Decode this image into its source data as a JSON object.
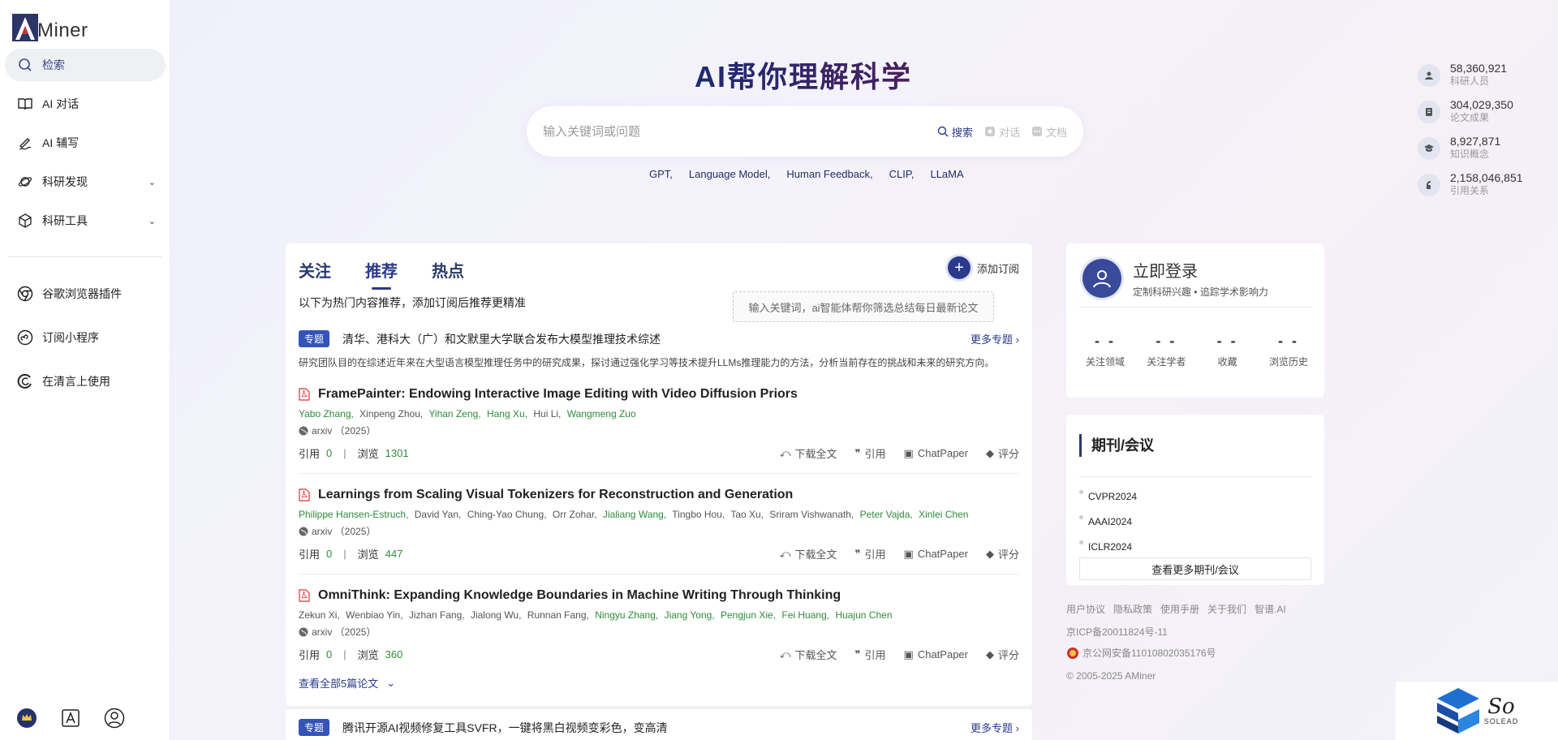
{
  "app": {
    "logo_text": "Miner",
    "logo_letter": "A"
  },
  "sidebar": {
    "items": [
      {
        "label": "检索",
        "icon": "search-icon"
      },
      {
        "label": "AI 对话",
        "icon": "book-icon"
      },
      {
        "label": "AI 辅写",
        "icon": "pen-icon"
      },
      {
        "label": "科研发现",
        "icon": "planet-icon"
      },
      {
        "label": "科研工具",
        "icon": "cube-icon"
      }
    ],
    "extras": [
      {
        "label": "谷歌浏览器插件",
        "icon": "chrome-icon"
      },
      {
        "label": "订阅小程序",
        "icon": "miniprogram-icon"
      },
      {
        "label": "在清言上使用",
        "icon": "chatglm-icon"
      }
    ]
  },
  "hero": {
    "title": "AI帮你理解科学",
    "search_placeholder": "输入关键词或问题",
    "search_label": "搜索",
    "chat_label": "对话",
    "doc_label": "文档",
    "hot_tags": [
      "GPT,",
      "Language Model,",
      "Human Feedback,",
      "CLIP,",
      "LLaMA"
    ]
  },
  "stats": [
    {
      "value": "58,360,921",
      "label": "科研人员",
      "icon": "person-icon"
    },
    {
      "value": "304,029,350",
      "label": "论文成果",
      "icon": "document-icon"
    },
    {
      "value": "8,927,871",
      "label": "知识概念",
      "icon": "graduation-cap-icon"
    },
    {
      "value": "2,158,046,851",
      "label": "引用关系",
      "icon": "quote-icon"
    }
  ],
  "feed": {
    "tabs": [
      "关注",
      "推荐",
      "热点"
    ],
    "active_tab": "推荐",
    "add_subscription": "添加订阅",
    "hint": "以下为热门内容推荐，添加订阅后推荐更精准",
    "tooltip": "输入关键词，ai智能体帮你筛选总结每日最新论文",
    "topic": {
      "badge": "专题",
      "title": "清华、港科大（广）和文默里大学联合发布大模型推理技术综述",
      "more": "更多专题",
      "desc": "研究团队目的在综述近年来在大型语言模型推理任务中的研究成果，探讨通过强化学习等技术提升LLMs推理能力的方法，分析当前存在的挑战和未来的研究方向。"
    },
    "papers": [
      {
        "title": "FramePainter: Endowing Interactive Image Editing with Video Diffusion Priors",
        "authors": [
          {
            "name": "Yabo Zhang,",
            "hl": true
          },
          {
            "name": "Xinpeng Zhou,",
            "hl": false
          },
          {
            "name": "Yihan Zeng,",
            "hl": true
          },
          {
            "name": "Hang Xu,",
            "hl": true
          },
          {
            "name": "Hui Li,",
            "hl": false
          },
          {
            "name": "Wangmeng Zuo",
            "hl": true
          }
        ],
        "venue": "arxiv （2025）",
        "cite_label": "引用",
        "cites": "0",
        "view_label": "浏览",
        "views": "1301"
      },
      {
        "title": "Learnings from Scaling Visual Tokenizers for Reconstruction and Generation",
        "authors": [
          {
            "name": "Philippe Hansen-Estruch,",
            "hl": true
          },
          {
            "name": "David Yan,",
            "hl": false
          },
          {
            "name": "Ching-Yao Chung,",
            "hl": false
          },
          {
            "name": "Orr Zohar,",
            "hl": false
          },
          {
            "name": "Jialiang Wang,",
            "hl": true
          },
          {
            "name": "Tingbo Hou,",
            "hl": false
          },
          {
            "name": "Tao Xu,",
            "hl": false
          },
          {
            "name": "Sriram Vishwanath,",
            "hl": false
          },
          {
            "name": "Peter Vajda,",
            "hl": true
          },
          {
            "name": "Xinlei Chen",
            "hl": true
          }
        ],
        "venue": "arxiv （2025）",
        "cite_label": "引用",
        "cites": "0",
        "view_label": "浏览",
        "views": "447"
      },
      {
        "title": "OmniThink: Expanding Knowledge Boundaries in Machine Writing Through Thinking",
        "authors": [
          {
            "name": "Zekun Xi,",
            "hl": false
          },
          {
            "name": "Wenbiao Yin,",
            "hl": false
          },
          {
            "name": "Jizhan Fang,",
            "hl": false
          },
          {
            "name": "Jialong Wu,",
            "hl": false
          },
          {
            "name": "Runnan Fang,",
            "hl": false
          },
          {
            "name": "Ningyu Zhang,",
            "hl": true
          },
          {
            "name": "Jiang Yong,",
            "hl": true
          },
          {
            "name": "Pengjun Xie,",
            "hl": true
          },
          {
            "name": "Fei Huang,",
            "hl": true
          },
          {
            "name": "Huajun Chen",
            "hl": true
          }
        ],
        "venue": "arxiv （2025）",
        "cite_label": "引用",
        "cites": "0",
        "view_label": "浏览",
        "views": "360"
      }
    ],
    "paper_actions": {
      "download": "下载全文",
      "cite": "引用",
      "chatpaper": "ChatPaper",
      "rate": "评分"
    },
    "see_all": "查看全部5篇论文",
    "topic2": {
      "badge": "专题",
      "title": "腾讯开源AI视频修复工具SVFR，一键将黑白视频变彩色，变高清",
      "more": "更多专题"
    }
  },
  "login": {
    "title": "立即登录",
    "subtitle": "定制科研兴趣 • 追踪学术影响力",
    "stats": [
      {
        "value": "- -",
        "label": "关注领域"
      },
      {
        "value": "- -",
        "label": "关注学者"
      },
      {
        "value": "- -",
        "label": "收藏"
      },
      {
        "value": "- -",
        "label": "浏览历史"
      }
    ]
  },
  "journals": {
    "title": "期刊/会议",
    "items": [
      "CVPR2024",
      "AAAI2024",
      "ICLR2024"
    ],
    "more": "查看更多期刊/会议"
  },
  "footer": {
    "links": [
      "用户协议",
      "隐私政策",
      "使用手册",
      "关于我们",
      "智谱.AI"
    ],
    "icp": "京ICP备20011824号-11",
    "police": "京公网安备11010802035176号",
    "copyright": "© 2005-2025 AMiner"
  },
  "watermark": {
    "script": "So",
    "sub": "SOLEAD"
  },
  "colors": {
    "brand": "#2a3a8a",
    "highlight_author": "#2e8b3a",
    "topic_badge": "#3553b8"
  }
}
